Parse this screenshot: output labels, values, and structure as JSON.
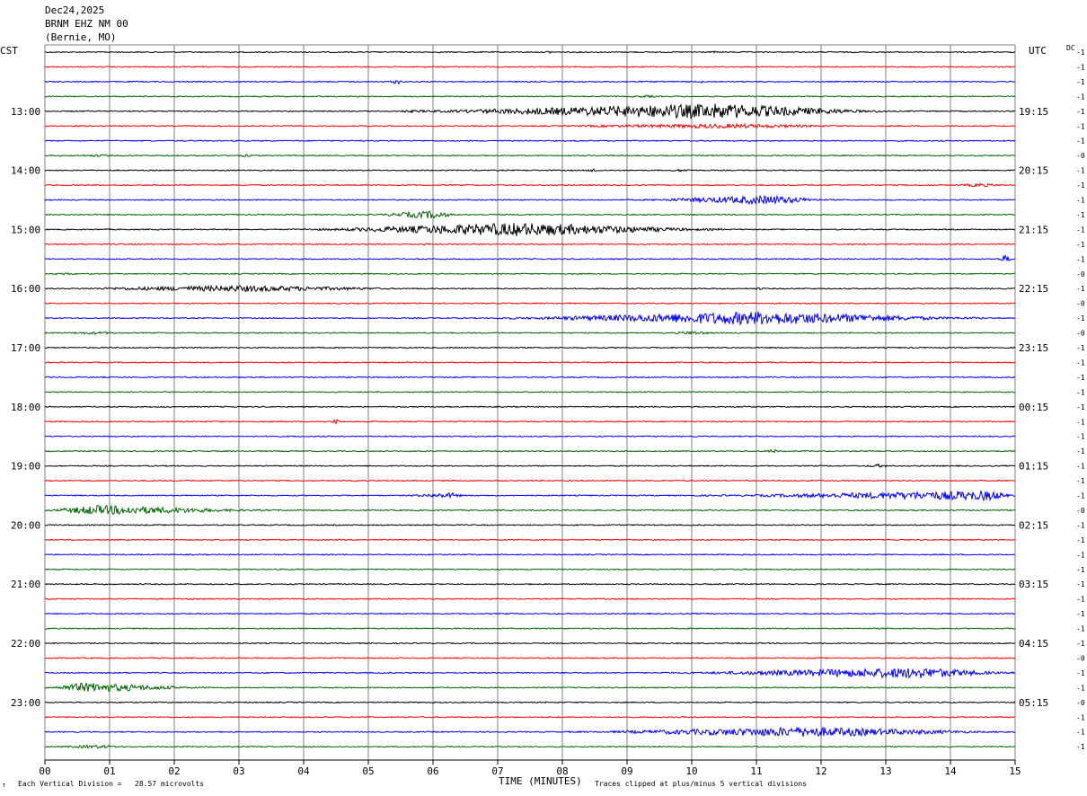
{
  "header": {
    "date": "Dec24,2025",
    "station": "BRNM EHZ NM 00",
    "location": "(Bernie, MO)"
  },
  "axis_titles": {
    "left_tz": "CST",
    "right_tz": "UTC",
    "dc_header": "DC",
    "x_title": "TIME (MINUTES)"
  },
  "footer": {
    "scale_note": "Each Vertical Division =   28.57 microvolts",
    "clip_note": "Traces clipped at plus/minus 5 vertical divisions",
    "corner_mark": "↑"
  },
  "colors": {
    "trace_cycle": [
      "#000000",
      "#ff0000",
      "#0000ff",
      "#006400"
    ],
    "grid": "#808080",
    "background": "#ffffff"
  },
  "chart_data": {
    "type": "line",
    "title": "Dec24,2025 BRNM EHZ NM 00 (Bernie, MO)",
    "xlabel": "TIME (MINUTES)",
    "x_ticks": [
      "00",
      "01",
      "02",
      "03",
      "04",
      "05",
      "06",
      "07",
      "08",
      "09",
      "10",
      "11",
      "12",
      "13",
      "14",
      "15"
    ],
    "xlim": [
      0,
      15
    ],
    "rows_per_hour": 4,
    "row_minutes": 15,
    "left_hour_labels": [
      "13:00",
      "14:00",
      "15:00",
      "16:00",
      "17:00",
      "18:00",
      "19:00",
      "20:00",
      "21:00",
      "22:00",
      "23:00"
    ],
    "right_hour_labels": [
      "19:15",
      "20:15",
      "21:15",
      "22:15",
      "23:15",
      "00:15",
      "01:15",
      "02:15",
      "03:15",
      "04:15",
      "05:15"
    ],
    "dc_offsets": [
      "-1",
      "-1",
      "-1",
      "-1",
      "-1",
      "-1",
      "-1",
      "-0",
      "-1",
      "-1",
      "-1",
      "-1",
      "-1",
      "-1",
      "-1",
      "-0",
      "-1",
      "-0",
      "-1",
      "-0",
      "-1",
      "-1",
      "-1",
      "-1",
      "-1",
      "-1",
      "-1",
      "-1",
      "-1",
      "-1",
      "-1",
      "-0",
      "-1",
      "-1",
      "-1",
      "-1",
      "-1",
      "-1",
      "-1",
      "-1",
      "-1",
      "-0",
      "-1",
      "-1",
      "-0",
      "-1",
      "-1",
      "-1"
    ],
    "events": [
      {
        "row": 0,
        "start": 7.7,
        "end": 7.9,
        "amp": 3,
        "freq": 15
      },
      {
        "row": 0,
        "start": 10.2,
        "end": 10.5,
        "amp": 2,
        "freq": 15
      },
      {
        "row": 2,
        "start": 5.3,
        "end": 5.6,
        "amp": 6,
        "freq": 15
      },
      {
        "row": 2,
        "start": 9.3,
        "end": 9.5,
        "amp": 2,
        "freq": 15
      },
      {
        "row": 2,
        "start": 10.1,
        "end": 10.2,
        "amp": 3,
        "freq": 15
      },
      {
        "row": 3,
        "start": 9.0,
        "end": 9.6,
        "amp": 3,
        "freq": 15
      },
      {
        "row": 4,
        "start": 5.5,
        "end": 13.0,
        "peak": 10.4,
        "amp": 17,
        "freq": 22
      },
      {
        "row": 5,
        "start": 7.0,
        "end": 13.0,
        "peak": 10.5,
        "amp": 5,
        "freq": 22
      },
      {
        "row": 7,
        "start": 0.4,
        "end": 1.2,
        "amp": 3,
        "freq": 15
      },
      {
        "row": 7,
        "start": 2.9,
        "end": 3.3,
        "amp": 3,
        "freq": 15
      },
      {
        "row": 8,
        "start": 8.3,
        "end": 8.7,
        "amp": 4,
        "freq": 15
      },
      {
        "row": 8,
        "start": 9.5,
        "end": 10.2,
        "amp": 3,
        "freq": 15
      },
      {
        "row": 9,
        "start": 13.9,
        "end": 15.0,
        "amp": 4,
        "freq": 15
      },
      {
        "row": 10,
        "start": 9.0,
        "end": 12.2,
        "peak": 11.2,
        "amp": 10,
        "freq": 20
      },
      {
        "row": 11,
        "start": 5.0,
        "end": 6.4,
        "peak": 6.0,
        "amp": 9,
        "freq": 18
      },
      {
        "row": 12,
        "start": 4.0,
        "end": 10.5,
        "peak": 7.3,
        "amp": 15,
        "freq": 22
      },
      {
        "row": 13,
        "start": 5.8,
        "end": 6.0,
        "amp": 3,
        "freq": 15
      },
      {
        "row": 14,
        "start": 14.7,
        "end": 15.0,
        "amp": 8,
        "freq": 15
      },
      {
        "row": 15,
        "start": 0.0,
        "end": 0.6,
        "amp": 3,
        "freq": 15
      },
      {
        "row": 16,
        "start": 0.0,
        "end": 6.0,
        "peak": 3.0,
        "amp": 7,
        "freq": 22
      },
      {
        "row": 16,
        "start": 10.9,
        "end": 11.2,
        "amp": 3,
        "freq": 15
      },
      {
        "row": 18,
        "start": 7.0,
        "end": 14.5,
        "peak": 11.0,
        "amp": 15,
        "freq": 20
      },
      {
        "row": 19,
        "start": 0.0,
        "end": 1.5,
        "amp": 3,
        "freq": 15
      },
      {
        "row": 19,
        "start": 9.5,
        "end": 10.5,
        "amp": 4,
        "freq": 15
      },
      {
        "row": 24,
        "start": 10.7,
        "end": 10.9,
        "amp": 3,
        "freq": 15
      },
      {
        "row": 25,
        "start": 4.4,
        "end": 4.6,
        "amp": 6,
        "freq": 15
      },
      {
        "row": 25,
        "start": 12.3,
        "end": 12.5,
        "amp": 3,
        "freq": 15
      },
      {
        "row": 27,
        "start": 11.1,
        "end": 11.4,
        "amp": 5,
        "freq": 15
      },
      {
        "row": 28,
        "start": 12.6,
        "end": 13.2,
        "amp": 4,
        "freq": 15
      },
      {
        "row": 30,
        "start": 5.4,
        "end": 6.5,
        "peak": 6.3,
        "amp": 6,
        "freq": 15
      },
      {
        "row": 30,
        "start": 10.0,
        "end": 15.0,
        "peak": 14.6,
        "amp": 11,
        "freq": 22
      },
      {
        "row": 31,
        "start": 0.0,
        "end": 3.5,
        "peak": 0.8,
        "amp": 11,
        "freq": 22
      },
      {
        "row": 42,
        "start": 9.5,
        "end": 15.0,
        "peak": 13.5,
        "amp": 12,
        "freq": 22
      },
      {
        "row": 43,
        "start": 0.0,
        "end": 2.5,
        "peak": 0.6,
        "amp": 11,
        "freq": 22
      },
      {
        "row": 46,
        "start": 8.0,
        "end": 15.0,
        "peak": 11.8,
        "amp": 11,
        "freq": 22
      },
      {
        "row": 47,
        "start": 0.0,
        "end": 1.5,
        "amp": 4,
        "freq": 18
      }
    ]
  }
}
